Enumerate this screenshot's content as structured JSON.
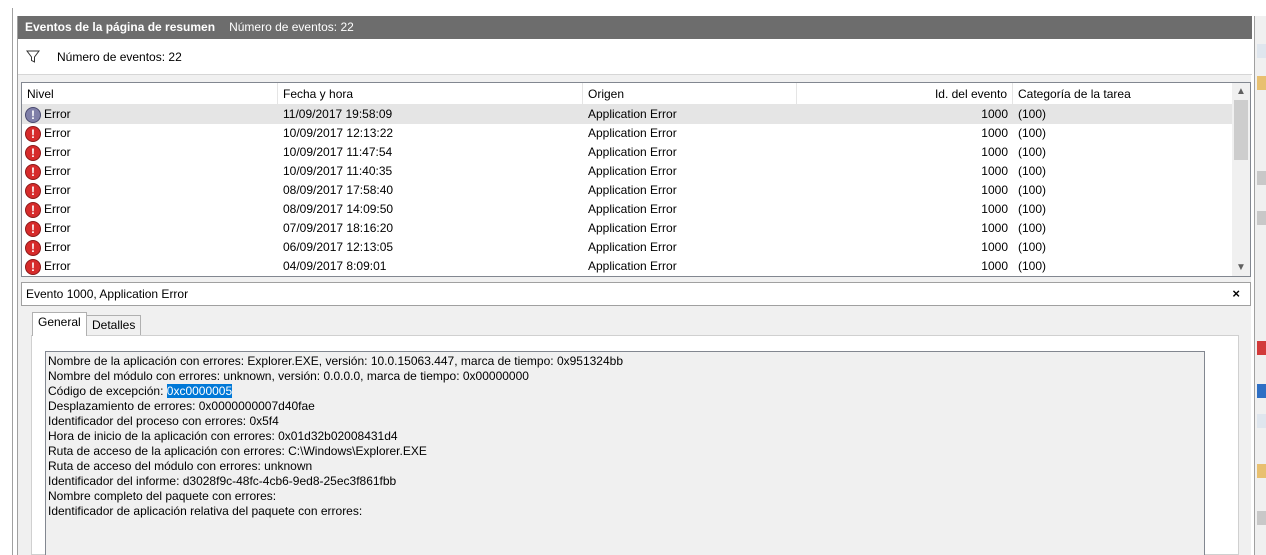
{
  "header": {
    "title": "Eventos de la página de resumen",
    "event_count": "Número de eventos: 22"
  },
  "filter": {
    "label": "Número de eventos: 22"
  },
  "grid": {
    "columns": [
      "Nivel",
      "Fecha y hora",
      "Origen",
      "Id. del evento",
      "Categoría de la tarea"
    ],
    "rows": [
      {
        "level": "Error",
        "datetime": "11/09/2017 19:58:09",
        "source": "Application Error",
        "event_id": "1000",
        "category": "(100)"
      },
      {
        "level": "Error",
        "datetime": "10/09/2017 12:13:22",
        "source": "Application Error",
        "event_id": "1000",
        "category": "(100)"
      },
      {
        "level": "Error",
        "datetime": "10/09/2017 11:47:54",
        "source": "Application Error",
        "event_id": "1000",
        "category": "(100)"
      },
      {
        "level": "Error",
        "datetime": "10/09/2017 11:40:35",
        "source": "Application Error",
        "event_id": "1000",
        "category": "(100)"
      },
      {
        "level": "Error",
        "datetime": "08/09/2017 17:58:40",
        "source": "Application Error",
        "event_id": "1000",
        "category": "(100)"
      },
      {
        "level": "Error",
        "datetime": "08/09/2017 14:09:50",
        "source": "Application Error",
        "event_id": "1000",
        "category": "(100)"
      },
      {
        "level": "Error",
        "datetime": "07/09/2017 18:16:20",
        "source": "Application Error",
        "event_id": "1000",
        "category": "(100)"
      },
      {
        "level": "Error",
        "datetime": "06/09/2017 12:13:05",
        "source": "Application Error",
        "event_id": "1000",
        "category": "(100)"
      },
      {
        "level": "Error",
        "datetime": "04/09/2017 8:09:01",
        "source": "Application Error",
        "event_id": "1000",
        "category": "(100)"
      }
    ]
  },
  "detail": {
    "title": "Evento 1000, Application Error",
    "close_symbol": "×",
    "tabs": [
      "General",
      "Detalles"
    ],
    "lines": [
      "Nombre de la aplicación con errores: Explorer.EXE, versión: 10.0.15063.447, marca de tiempo: 0x951324bb",
      "Nombre del módulo con errores: unknown, versión: 0.0.0.0, marca de tiempo: 0x00000000",
      "Desplazamiento de errores: 0x0000000007d40fae",
      "Identificador del proceso con errores: 0x5f4",
      "Hora de inicio de la aplicación con errores: 0x01d32b02008431d4",
      "Ruta de acceso de la aplicación con errores: C:\\Windows\\Explorer.EXE",
      "Ruta de acceso del módulo con errores: unknown",
      "Identificador del informe: d3028f9c-48fc-4cb6-9ed8-25ec3f861fbb",
      "Nombre completo del paquete con errores:",
      "Identificador de aplicación relativa del paquete con errores:"
    ],
    "exception_label": "Código de excepción:",
    "exception_code": "0xc0000005"
  },
  "colors": {
    "title_bar": "#6d6d6d",
    "error_icon": "#d62b2b",
    "selection_highlight": "#0078d7"
  }
}
